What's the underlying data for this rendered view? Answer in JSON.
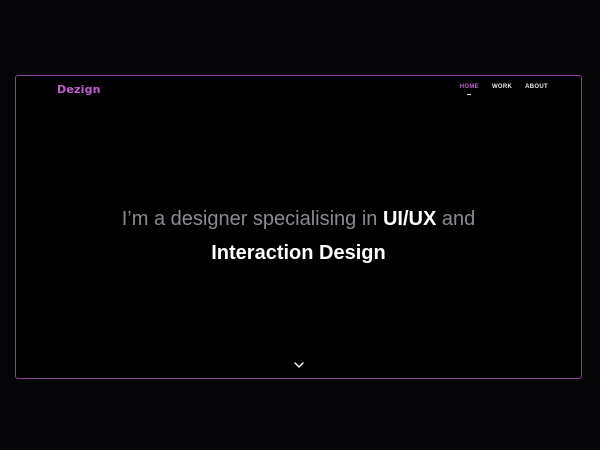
{
  "brand": {
    "logo_text": "Dezign",
    "accent_color": "#c75ad6",
    "border_color": "#8b3f9a"
  },
  "nav": {
    "items": [
      {
        "label": "HOME",
        "active": true
      },
      {
        "label": "WORK",
        "active": false
      },
      {
        "label": "ABOUT",
        "active": false
      }
    ]
  },
  "hero": {
    "line1_part1": "I’m a designer specialising in ",
    "line1_bold": "UI/UX",
    "line1_part2": " and",
    "line2_bold": "Interaction Design"
  },
  "icons": {
    "scroll_down": "chevron-down-icon"
  }
}
